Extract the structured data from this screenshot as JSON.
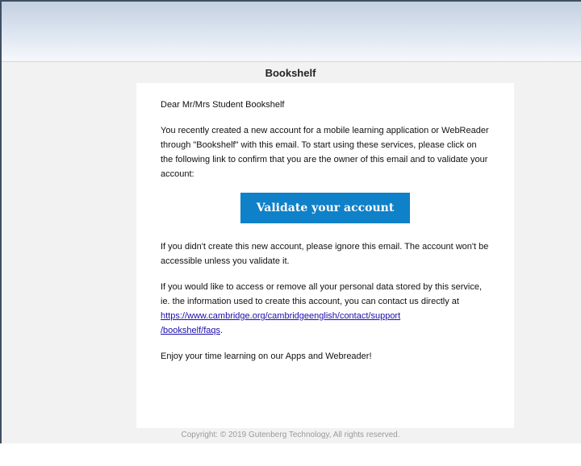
{
  "email": {
    "title": "Bookshelf",
    "greeting": "Dear Mr/Mrs Student Bookshelf",
    "intro": "You recently created a new account for a mobile learning application or WebReader through \"Bookshelf\" with this email. To start using these services, please click on the following link to confirm that you are the owner of this email and to validate your account:",
    "cta_label": "Validate your account",
    "ignore_notice": "If you didn't create this new account, please ignore this email. The account won't be accessible unless you validate it.",
    "data_notice_prefix": "If you would like to access or remove all your personal data stored by this service, ie. the information used to create this account, you can contact us directly at ",
    "support_link_line1": "https://www.cambridge.org/cambridgeenglish/contact/support",
    "support_link_line2": "/bookshelf/faqs",
    "data_notice_suffix": ".",
    "closing": "Enjoy your time learning on our Apps and Webreader!",
    "copyright": "Copyright: © 2019 Gutenberg Technology, All rights reserved."
  },
  "colors": {
    "cta_background": "#0f81c9",
    "link": "#1a0dab",
    "page_background": "#f2f2f2"
  }
}
